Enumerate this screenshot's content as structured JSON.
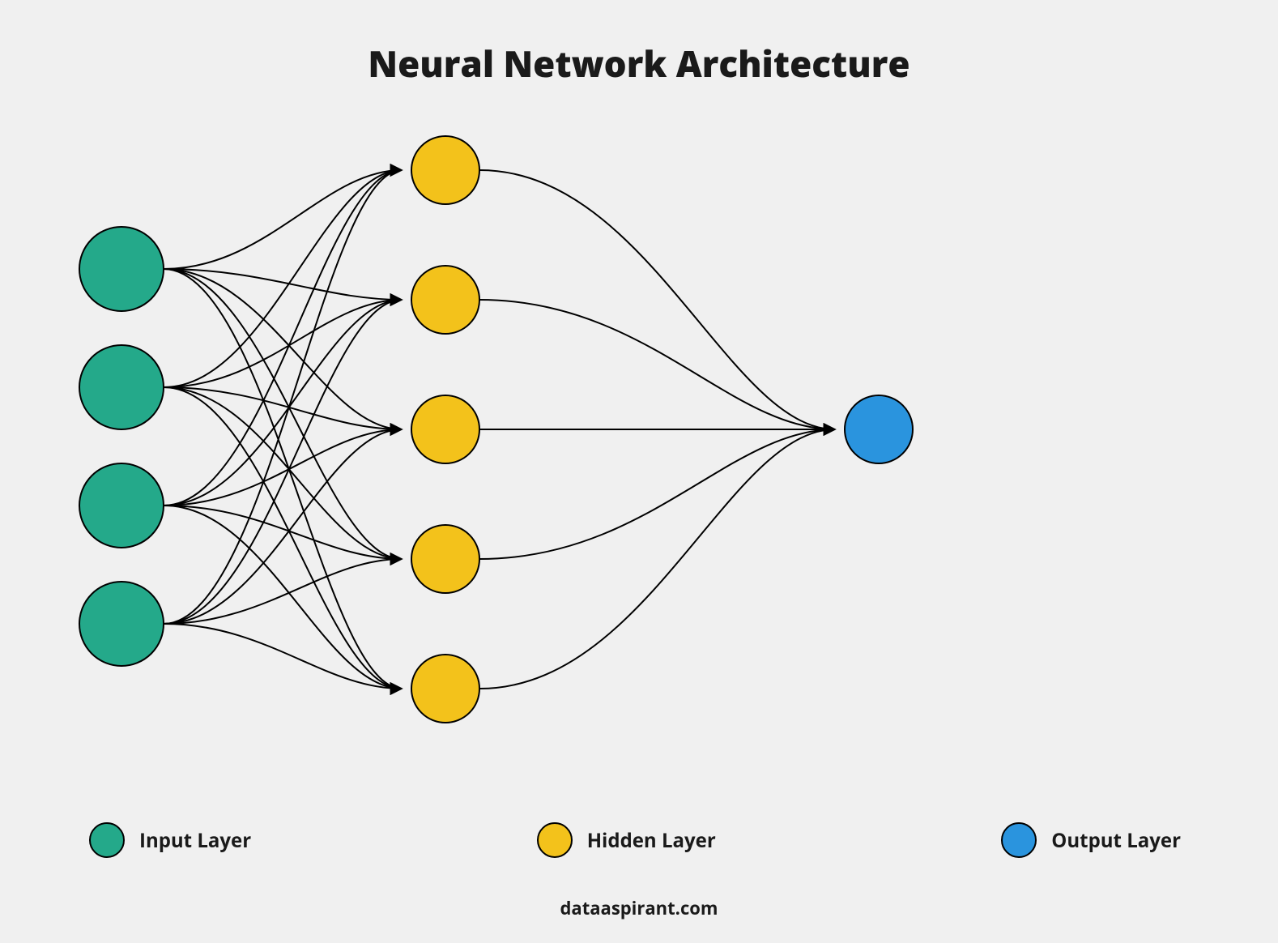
{
  "title": "Neural Network Architecture",
  "legend": {
    "input": "Input Layer",
    "hidden": "Hidden Layer",
    "output": "Output Layer"
  },
  "credit": "dataaspirant.com",
  "colors": {
    "input": "#24a98a",
    "hidden": "#f3c21b",
    "output": "#2a94de",
    "stroke": "#000000",
    "bg": "#f0f0f0"
  },
  "chart_data": {
    "type": "diagram",
    "description": "Feed-forward neural network architecture diagram",
    "layers": [
      {
        "name": "input",
        "nodes": 4,
        "color_key": "input"
      },
      {
        "name": "hidden",
        "nodes": 5,
        "color_key": "hidden"
      },
      {
        "name": "output",
        "nodes": 1,
        "color_key": "output"
      }
    ],
    "connections": "fully-connected between consecutive layers with directed arrows"
  }
}
